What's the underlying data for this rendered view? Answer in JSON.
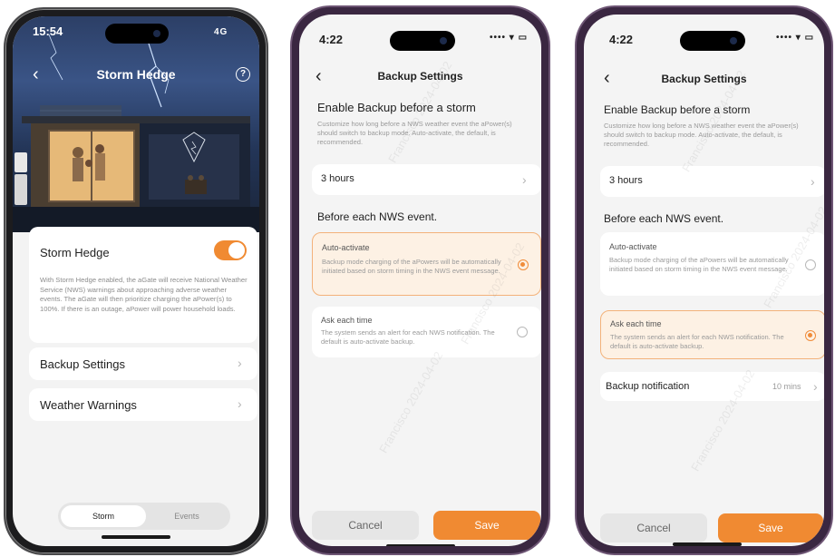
{
  "phone1": {
    "status_time": "15:54",
    "status_right": "4G",
    "nav_title": "Storm Hedge",
    "help_icon": "?",
    "storm_card": {
      "label": "Storm Hedge",
      "toggle_on": true,
      "description": "With Storm Hedge enabled, the aGate will receive National Weather Service (NWS) warnings about approaching adverse weather events. The aGate will then prioritize charging the aPower(s) to 100%. If there is an outage, aPower will power household loads."
    },
    "rows": [
      "Backup Settings",
      "Weather Warnings"
    ],
    "segmented": {
      "active": "Storm",
      "inactive": "Events"
    }
  },
  "phone2": {
    "status_time": "4:22",
    "nav_title": "Backup Settings",
    "section1_title": "Enable Backup before a storm",
    "section1_desc": "Customize how long before a NWS weather event the aPower(s) should switch to backup mode. Auto-activate, the default, is recommended.",
    "duration": "3 hours",
    "section2_title": "Before each NWS event.",
    "option1": {
      "title": "Auto-activate",
      "desc": "Backup mode charging of the aPowers will be automatically initiated based on storm timing in the NWS event message.",
      "selected": true
    },
    "option2": {
      "title": "Ask each time",
      "desc": "The system sends an alert for each NWS notification. The default is auto-activate backup.",
      "selected": false
    },
    "cancel": "Cancel",
    "save": "Save"
  },
  "phone3": {
    "status_time": "4:22",
    "nav_title": "Backup Settings",
    "section1_title": "Enable Backup before a storm",
    "section1_desc": "Customize how long before a NWS weather event the aPower(s) should switch to backup mode. Auto-activate, the default, is recommended.",
    "duration": "3 hours",
    "section2_title": "Before each NWS event.",
    "option1": {
      "title": "Auto-activate",
      "desc": "Backup mode charging of the aPowers will be automatically initiated based on storm timing in the NWS event message.",
      "selected": false
    },
    "option2": {
      "title": "Ask each time",
      "desc": "The system sends an alert for each NWS notification. The default is auto-activate backup.",
      "selected": true
    },
    "notification_label": "Backup notification",
    "notification_value": "10 mins",
    "cancel": "Cancel",
    "save": "Save"
  },
  "colors": {
    "accent": "#f08a32",
    "selected_bg": "#fdf1e4",
    "screen_bg": "#f3f3f3"
  }
}
